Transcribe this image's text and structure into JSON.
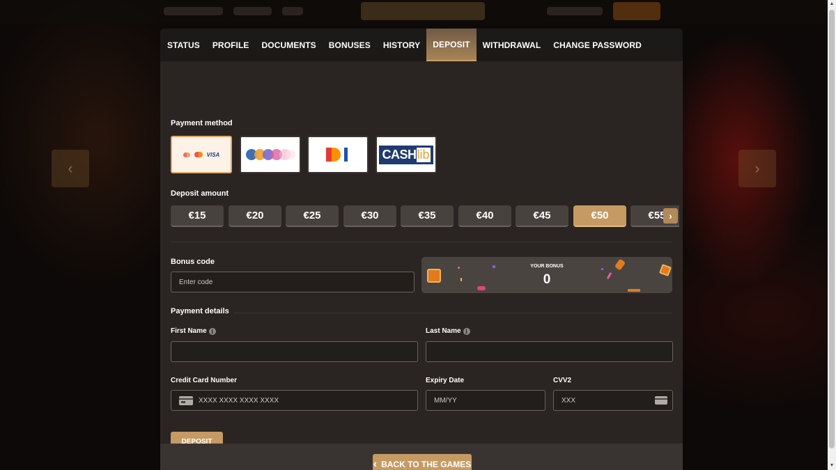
{
  "tabs": [
    {
      "label": "STATUS"
    },
    {
      "label": "PROFILE"
    },
    {
      "label": "DOCUMENTS"
    },
    {
      "label": "BONUSES"
    },
    {
      "label": "HISTORY"
    },
    {
      "label": "DEPOSIT",
      "active": true
    },
    {
      "label": "WITHDRAWAL"
    },
    {
      "label": "CHANGE PASSWORD"
    }
  ],
  "payment_method": {
    "label": "Payment method",
    "methods": [
      {
        "name": "visa-mastercard",
        "text": "VISA",
        "selected": true
      },
      {
        "name": "crypto",
        "text": ""
      },
      {
        "name": "bank-transfer",
        "text": ""
      },
      {
        "name": "cashlib",
        "text": "CASH",
        "text_suffix": "lib"
      }
    ]
  },
  "deposit_amount": {
    "label": "Deposit amount",
    "amounts": [
      "€15",
      "€20",
      "€25",
      "€30",
      "€35",
      "€40",
      "€45",
      "€50",
      "€55"
    ],
    "selected": "€50"
  },
  "bonus": {
    "label": "Bonus code",
    "placeholder": "Enter code",
    "your_bonus_label": "YOUR BONUS",
    "your_bonus_value": "0"
  },
  "payment_details": {
    "label": "Payment details",
    "first_name_label": "First Name",
    "last_name_label": "Last Name",
    "card_number_label": "Credit Card Number",
    "card_number_placeholder": "XXXX XXXX XXXX XXXX",
    "expiry_label": "Expiry Date",
    "expiry_placeholder": "MM/YY",
    "cvv_label": "CVV2",
    "cvv_placeholder": "XXX"
  },
  "deposit_button": "DEPOSIT",
  "back_button": "BACK TO THE GAMES",
  "colors": {
    "accent": "#c69a63",
    "panel": "#2a2522",
    "tabbar": "#1c1a19"
  }
}
